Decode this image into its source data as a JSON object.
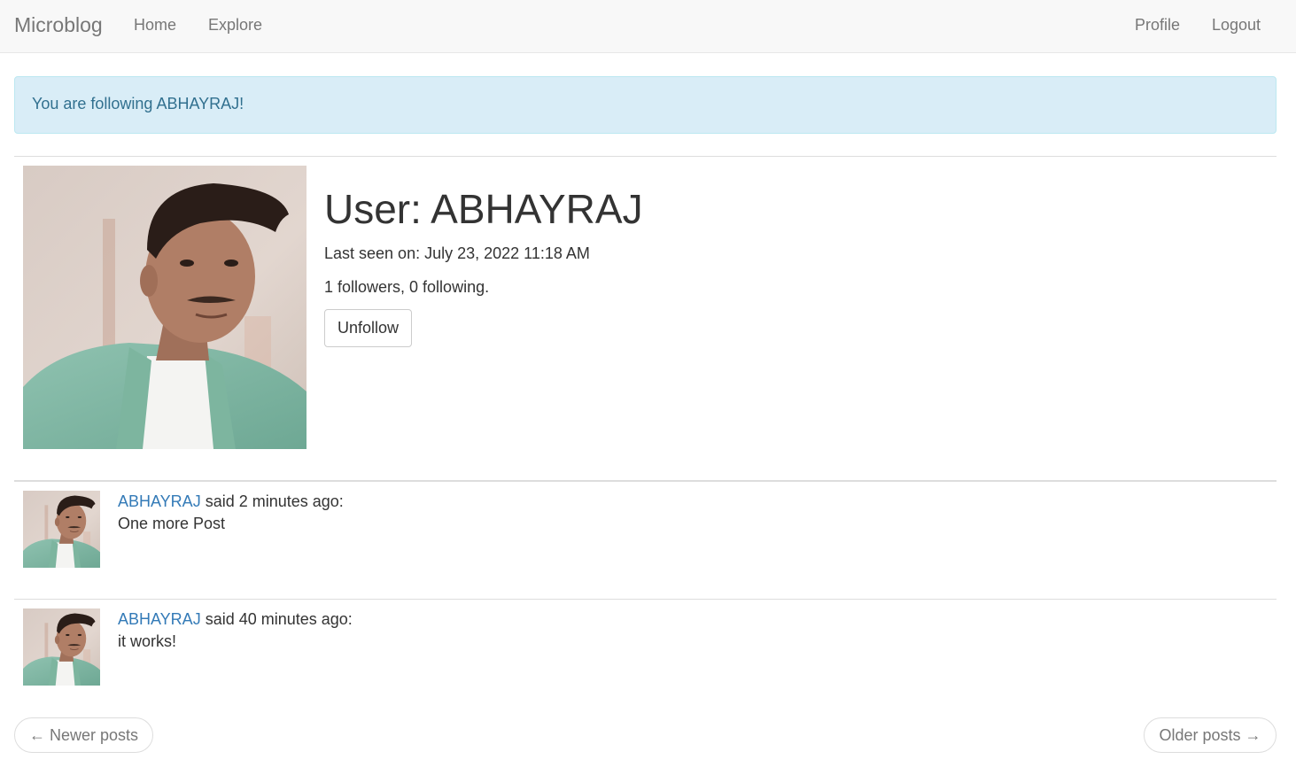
{
  "navbar": {
    "brand": "Microblog",
    "left_links": [
      "Home",
      "Explore"
    ],
    "right_links": [
      "Profile",
      "Logout"
    ]
  },
  "flash_message": "You are following ABHAYRAJ!",
  "profile": {
    "title": "User: ABHAYRAJ",
    "last_seen": "Last seen on: July 23, 2022 11:18 AM",
    "follow_counts": "1 followers, 0 following.",
    "unfollow_label": "Unfollow"
  },
  "posts": [
    {
      "author": "ABHAYRAJ",
      "said": " said 2 minutes ago:",
      "body": "One more Post"
    },
    {
      "author": "ABHAYRAJ",
      "said": " said 40 minutes ago:",
      "body": "it works!"
    }
  ],
  "pager": {
    "newer": "← Newer posts",
    "older": "Older posts →"
  },
  "colors": {
    "link": "#337ab7",
    "alert_bg": "#d9edf7",
    "alert_text": "#31708f",
    "navbar_bg": "#f8f8f8"
  },
  "icons": {
    "profile_photo": "user-avatar-photo"
  }
}
